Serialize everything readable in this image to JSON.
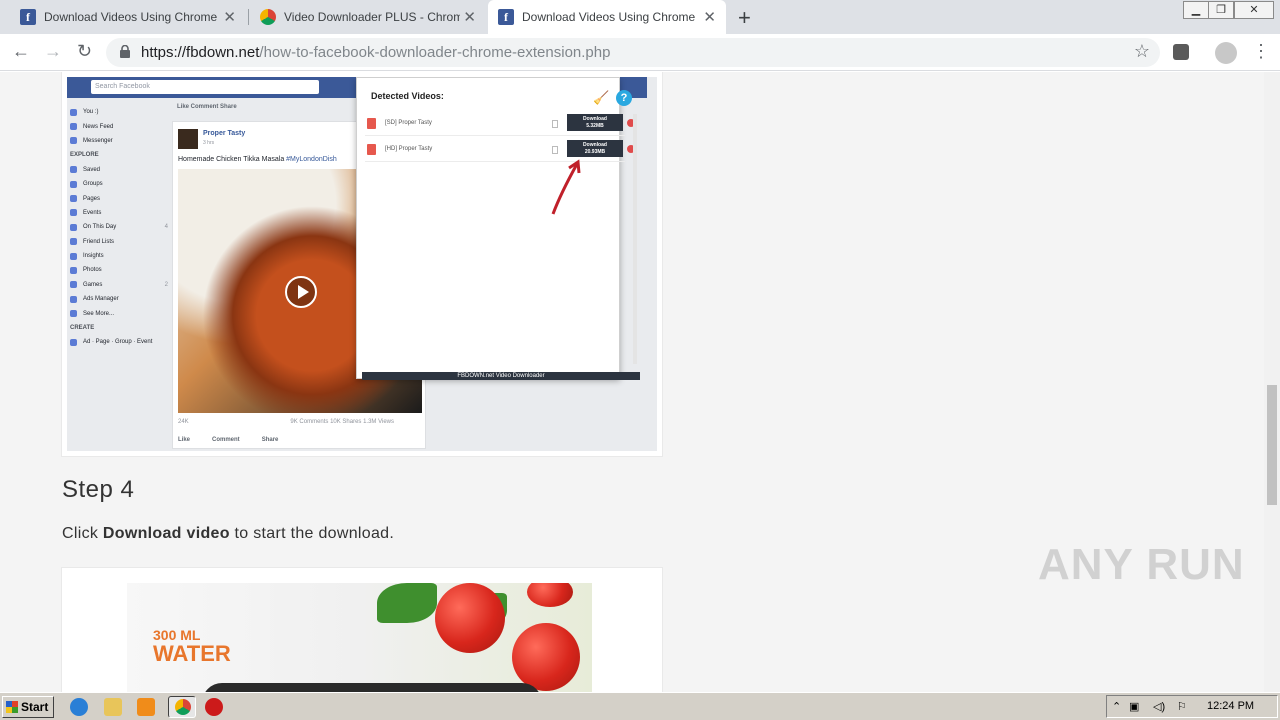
{
  "browser": {
    "tabs": [
      {
        "title": "Download Videos Using Chrome Exte",
        "favicon": "facebook-icon",
        "active": false
      },
      {
        "title": "Video Downloader PLUS - Chrome We",
        "favicon": "chrome-webstore-icon",
        "active": false
      },
      {
        "title": "Download Videos Using Chrome Exte",
        "favicon": "facebook-icon",
        "active": true
      }
    ],
    "new_tab": "+",
    "url_host": "https://fbdown.net",
    "url_path": "/how-to-facebook-downloader-chrome-extension.php"
  },
  "fb_screenshot": {
    "search_placeholder": "Search Facebook",
    "sidebar": [
      {
        "label": "You :)",
        "count": ""
      },
      {
        "label": "News Feed",
        "count": ""
      },
      {
        "label": "Messenger",
        "count": ""
      },
      {
        "label": "EXPLORE",
        "count": "",
        "header": true
      },
      {
        "label": "Saved",
        "count": ""
      },
      {
        "label": "Groups",
        "count": ""
      },
      {
        "label": "Pages",
        "count": ""
      },
      {
        "label": "Events",
        "count": ""
      },
      {
        "label": "On This Day",
        "count": "4"
      },
      {
        "label": "Friend Lists",
        "count": ""
      },
      {
        "label": "Insights",
        "count": ""
      },
      {
        "label": "Photos",
        "count": ""
      },
      {
        "label": "Games",
        "count": "2"
      },
      {
        "label": "Ads Manager",
        "count": ""
      },
      {
        "label": "See More...",
        "count": ""
      },
      {
        "label": "CREATE",
        "count": "",
        "header": true
      },
      {
        "label": "Ad · Page · Group · Event",
        "count": ""
      }
    ],
    "top_actions": "Like   Comment   Share",
    "post_author": "Proper Tasty",
    "post_time": "3 hrs",
    "post_caption": "Homemade Chicken Tikka Masala ",
    "post_hashtag": "#MyLondonDish",
    "reactions": "24K",
    "stats": "9K Comments  10K Shares  1.3M Views",
    "actions": [
      "Like",
      "Comment",
      "Share"
    ]
  },
  "popup": {
    "title": "Detected Videos:",
    "videos": [
      {
        "label": "[SD] Proper Tasty",
        "button": "Download",
        "size": "5.32MB"
      },
      {
        "label": "[HD] Proper Tasty",
        "button": "Download",
        "size": "20.93MB"
      }
    ],
    "footer": "FBDOWN.net Video Downloader"
  },
  "article": {
    "step_title": "Step 4",
    "step_pre": "Click ",
    "step_bold": "Download video",
    "step_post": " to start the download."
  },
  "recipe_image": {
    "line1": "300 ML",
    "line2": "WATER"
  },
  "watermark": "ANY RUN",
  "taskbar": {
    "start": "Start",
    "clock": "12:24 PM"
  }
}
